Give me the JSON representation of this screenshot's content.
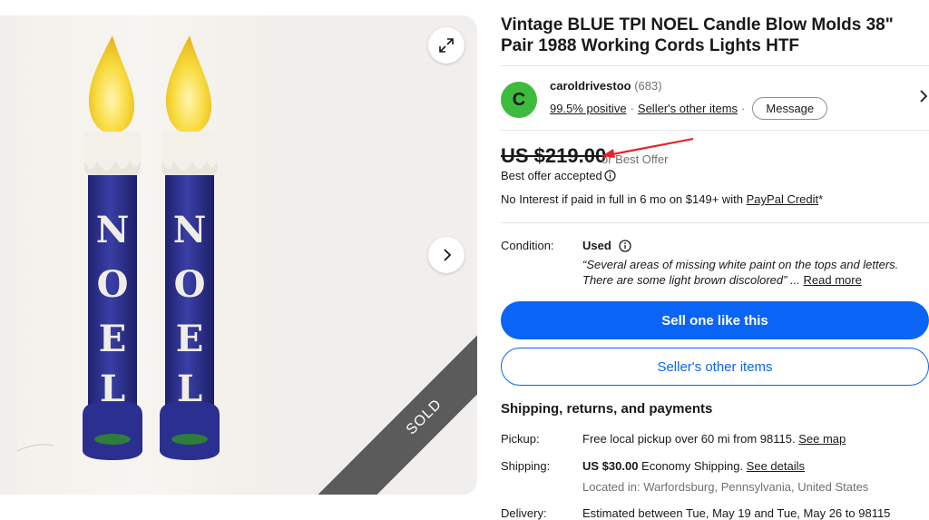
{
  "listing": {
    "title": "Vintage BLUE TPI NOEL Candle Blow Molds 38\" Pair 1988 Working Cords Lights HTF",
    "sold_badge": "SOLD"
  },
  "seller": {
    "avatar_letter": "C",
    "name": "caroldrivestoo",
    "feedback_count": "(683)",
    "positive": "99.5% positive",
    "other_items_link": "Seller's other items",
    "message_button": "Message"
  },
  "price": {
    "amount": "US $219.00",
    "offer_note": "or Best Offer",
    "accepted": "Best offer accepted",
    "credit_prefix": "No Interest if paid in full in 6 mo on $149+ with ",
    "credit_link": "PayPal Credit",
    "credit_suffix": "*"
  },
  "condition": {
    "label": "Condition:",
    "value": "Used",
    "description": "“Several areas of missing white paint on the tops and letters. There are some light brown discolored”",
    "ellipsis": "...",
    "read_more": "Read more"
  },
  "actions": {
    "sell_one": "Sell one like this",
    "seller_other_items": "Seller's other items"
  },
  "shipping": {
    "heading": "Shipping, returns, and payments",
    "pickup_label": "Pickup:",
    "pickup_text": "Free local pickup over 60 mi from 98115. ",
    "pickup_link": "See map",
    "shipping_label": "Shipping:",
    "shipping_price": "US $30.00",
    "shipping_method": " Economy Shipping. ",
    "shipping_link": "See details",
    "located": "Located in: Warfordsburg, Pennsylvania, United States",
    "delivery_label": "Delivery:",
    "delivery_text": "Estimated between Tue, May 19 and Tue, May 26 to 98115"
  },
  "noel_letters": [
    "N",
    "O",
    "E",
    "L"
  ],
  "colors": {
    "accent_blue": "#0a64f5",
    "candle_blue": "#2c2f8a",
    "avatar_green": "#3dbb3d",
    "annotation_red": "#e5232a"
  }
}
